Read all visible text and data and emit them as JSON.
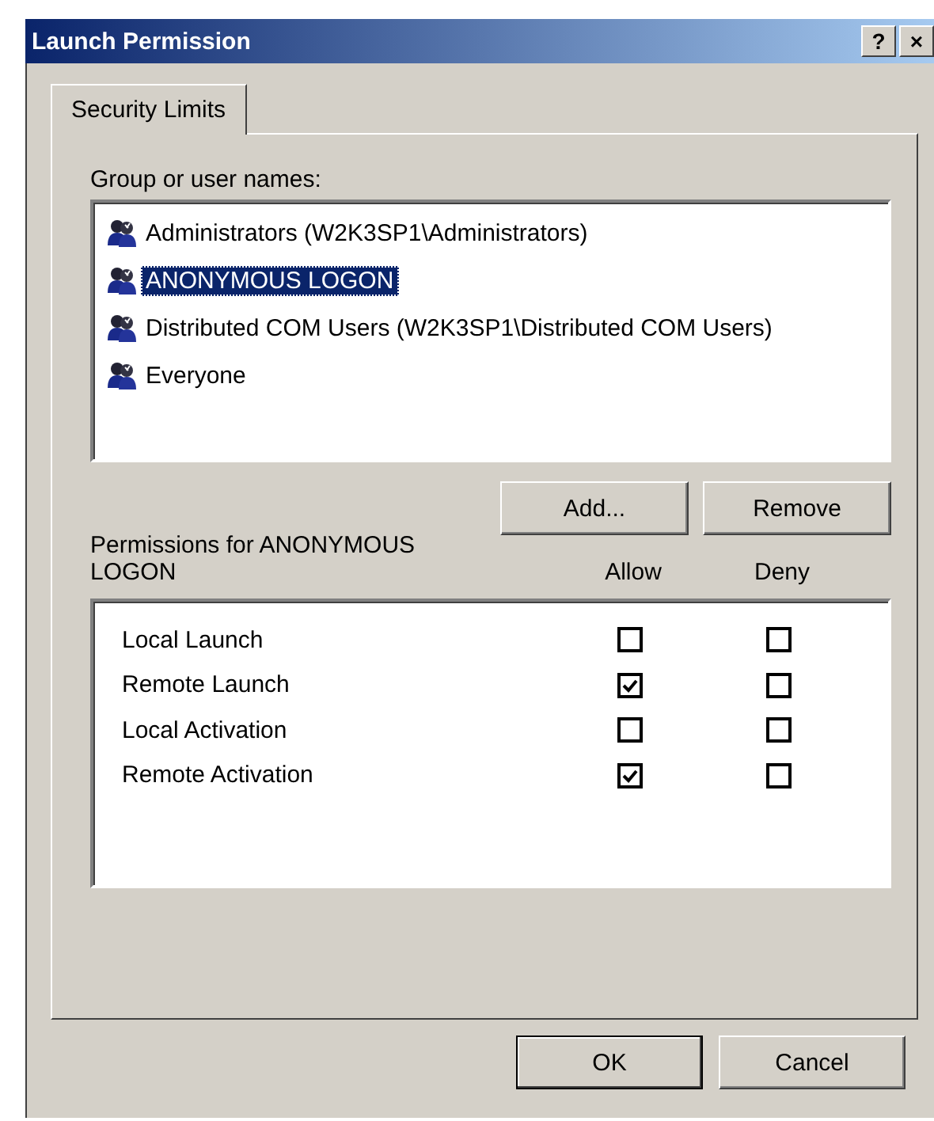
{
  "window": {
    "title": "Launch Permission",
    "title_buttons": [
      "?",
      "×"
    ]
  },
  "tabs": [
    {
      "label": "Security Limits",
      "selected": true
    }
  ],
  "groups": {
    "label": "Group or user names:",
    "items": [
      {
        "name": "Administrators (W2K3SP1\\Administrators)",
        "selected": false
      },
      {
        "name": "ANONYMOUS LOGON",
        "selected": true
      },
      {
        "name": "Distributed COM Users (W2K3SP1\\Distributed COM Users)",
        "selected": false
      },
      {
        "name": "Everyone",
        "selected": false
      }
    ]
  },
  "group_buttons": [
    "Add...",
    "Remove"
  ],
  "permissions": {
    "label": "Permissions for ANONYMOUS LOGON",
    "columns": [
      "Allow",
      "Deny"
    ],
    "rows": [
      {
        "name": "Local Launch",
        "allow": false,
        "deny": false
      },
      {
        "name": "Remote Launch",
        "allow": true,
        "deny": false
      },
      {
        "name": "Local Activation",
        "allow": false,
        "deny": false
      },
      {
        "name": "Remote Activation",
        "allow": true,
        "deny": false
      }
    ]
  },
  "buttons": [
    "OK",
    "Cancel"
  ]
}
